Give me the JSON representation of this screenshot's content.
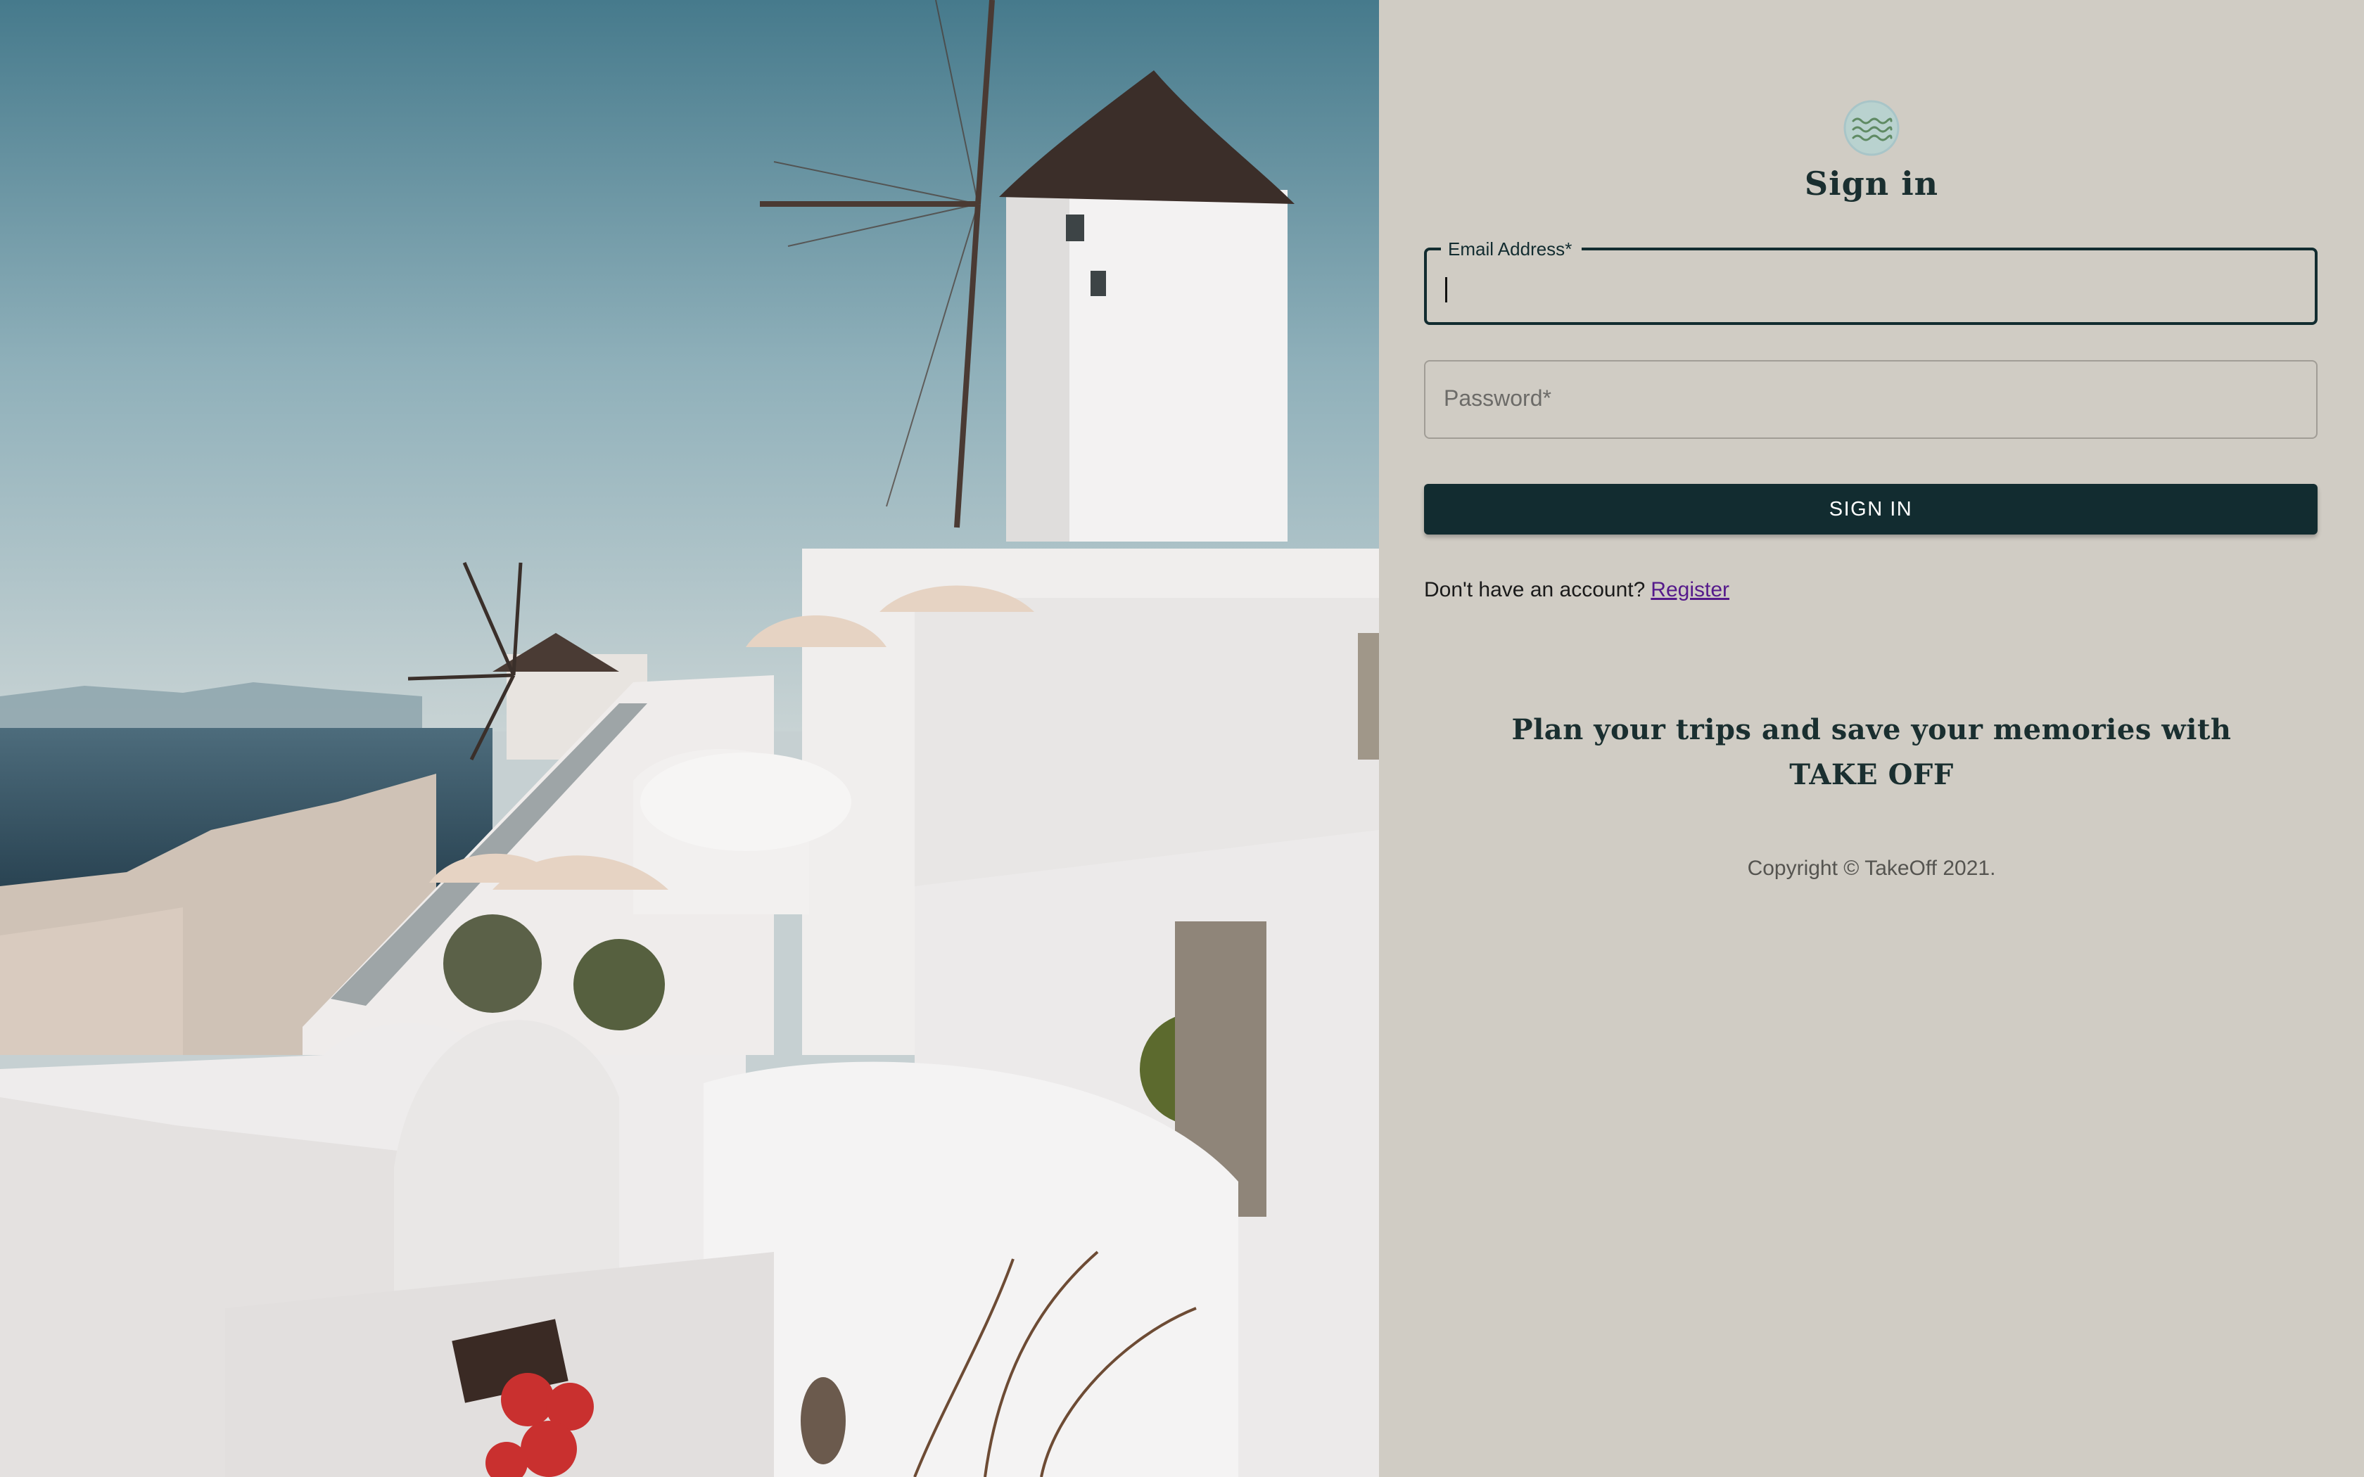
{
  "hero": {
    "image_name": "santorini-windmill-photo"
  },
  "signin": {
    "logo_icon": "waves-logo-icon",
    "title": "Sign in",
    "email": {
      "label": "Email Address",
      "required_mark": "*",
      "value": ""
    },
    "password": {
      "placeholder": "Password",
      "required_mark": "*",
      "value": ""
    },
    "submit_label": "SIGN IN",
    "register_prompt": "Don't have an account?",
    "register_link": "Register"
  },
  "tagline": {
    "line1": "Plan your trips and save your memories with",
    "line2": "TAKE OFF"
  },
  "footer": {
    "copyright": "Copyright © TakeOff 2021."
  },
  "colors": {
    "panel_bg": "#d0ccc4",
    "primary": "#122c30",
    "link": "#551a8b"
  }
}
